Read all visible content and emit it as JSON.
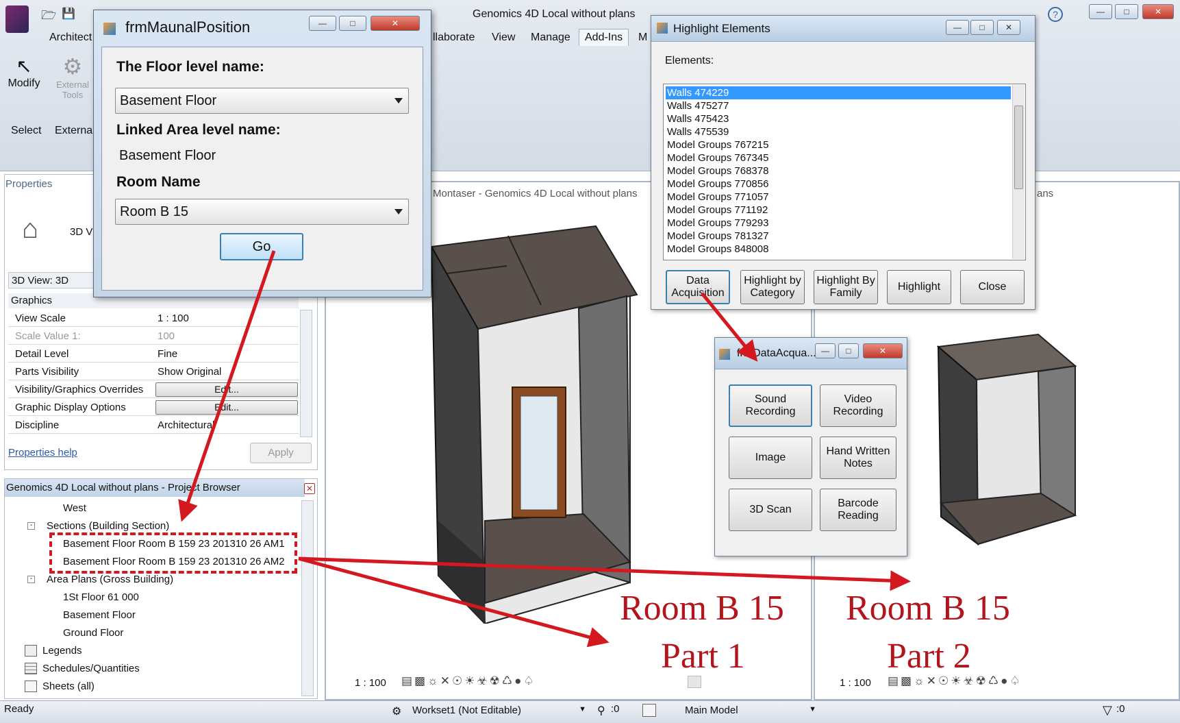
{
  "revit": {
    "title": "Genomics 4D Local without plans",
    "ribbon_tabs": [
      "Architect",
      "llaborate",
      "View",
      "Manage",
      "Add-Ins",
      "M"
    ],
    "ribbon": {
      "modify": "Modify",
      "select": "Select",
      "external_tools": "External Tools",
      "external": "External"
    },
    "properties": {
      "header": "Properties",
      "type_label": "3D V",
      "view_select": "3D View: 3D",
      "section": "Graphics",
      "rows": [
        {
          "key": "View Scale",
          "value": "1 : 100"
        },
        {
          "key": "Scale Value    1:",
          "value": "100"
        },
        {
          "key": "Detail Level",
          "value": "Fine"
        },
        {
          "key": "Parts Visibility",
          "value": "Show Original"
        },
        {
          "key": "Visibility/Graphics Overrides",
          "value": "Edit..."
        },
        {
          "key": "Graphic Display Options",
          "value": "Edit..."
        },
        {
          "key": "Discipline",
          "value": "Architectural"
        }
      ],
      "help_link": "Properties help",
      "apply": "Apply"
    },
    "project_browser": {
      "title": "Genomics 4D Local without plans - Project Browser",
      "items": [
        "West",
        "Sections (Building Section)",
        "Basement Floor Room B 159 23 201310 26 AM1",
        "Basement Floor Room B 159 23 201310 26 AM2",
        "Area Plans (Gross Building)",
        "1St Floor 61 000",
        "Basement Floor",
        "Ground Floor",
        "Legends",
        "Schedules/Quantities",
        "Sheets (all)"
      ]
    },
    "view1_title": "Montaser - Genomics 4D Local without plans",
    "view2_title": "ans",
    "scale1": "1 : 100",
    "scale2": "1 : 100",
    "status_bar": {
      "ready": "Ready",
      "workset": "Workset1 (Not Editable)",
      "counter": ":0",
      "model": "Main Model",
      "filter": ":0"
    }
  },
  "frm_manual_position": {
    "title": "frmMaunalPosition",
    "floor_label": "The Floor level  name:",
    "floor_value": "Basement Floor",
    "linked_label": "Linked Area level  name:",
    "linked_value": "Basement Floor",
    "room_label": "Room Name",
    "room_value": "Room B 15",
    "go_button": "Go"
  },
  "highlight_elements": {
    "title": "Highlight Elements",
    "elements_label": "Elements:",
    "items": [
      "Walls  474229",
      "Walls  475277",
      "Walls  475423",
      "Walls  475539",
      "Model Groups  767215",
      "Model Groups  767345",
      "Model Groups  768378",
      "Model Groups  770856",
      "Model Groups  771057",
      "Model Groups  771192",
      "Model Groups  779293",
      "Model Groups  781327",
      "Model Groups  848008"
    ],
    "buttons": [
      "Data Acquisition",
      "Highlight by Category",
      "Highlight By Family",
      "Highlight",
      "Close"
    ]
  },
  "frm_data_acquisition": {
    "title": "frmDataAcqua...",
    "buttons": [
      "Sound Recording",
      "Video Recording",
      "Image",
      "Hand Written Notes",
      "3D Scan",
      "Barcode Reading"
    ]
  },
  "annotations": {
    "part1_line1": "Room B 15",
    "part1_line2": "Part 1",
    "part2_line1": "Room B 15",
    "part2_line2": "Part 2"
  },
  "colors": {
    "arrow": "#d4181f",
    "label": "#b3151c",
    "selection": "#3399ff"
  }
}
